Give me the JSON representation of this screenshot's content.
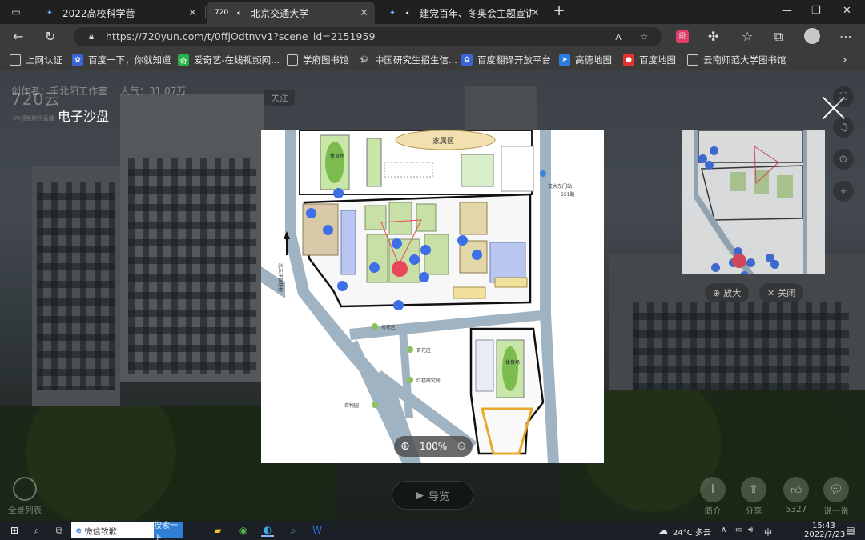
{
  "browser": {
    "tabs": [
      {
        "title": "2022高校科学营",
        "icon": "compass-icon"
      },
      {
        "title": "北京交通大学",
        "icon": "speaker-icon",
        "favicon_text": "720"
      },
      {
        "title": "建党百年、冬奥会主题宣讲",
        "icon": "speaker-icon"
      }
    ],
    "url": "https://720yun.com/t/0ffjOdtnvv1?scene_id=2151959",
    "bookmarks": [
      "上网认证",
      "百度一下，你就知道",
      "爱奇艺-在线视频网...",
      "学府图书馆",
      "中国研究生招生信...",
      "百度翻译开放平台",
      "高德地图",
      "百度地图",
      "云南师范大学图书馆"
    ]
  },
  "pano": {
    "logo": "720云",
    "logo_sub": "VR视频制作直播",
    "author": "创作者：千北阳工作室",
    "popularity": "人气：31.07万",
    "follow_label": "关注",
    "panel_title": "电子沙盘",
    "zoom_level": "100%",
    "mini": {
      "zoom_in": "放大",
      "close": "关闭"
    },
    "guide_label": "导览",
    "panorama_list_label": "全景列表",
    "bottom_actions": [
      {
        "label": "简介",
        "icon": "info-icon"
      },
      {
        "label": "分享",
        "icon": "share-icon"
      },
      {
        "label": "5327",
        "icon": "thumbs-up-icon"
      },
      {
        "label": "说一说",
        "icon": "comment-icon"
      }
    ],
    "map_labels": {
      "family_area": "家属区",
      "stadium_north": "体育场",
      "stadium_south": "体育场",
      "bus_stop": "交大东门站",
      "bus_line": "651路",
      "north_ring": "北三环联想桥",
      "plum_garden": "梅花区",
      "garden_2": "百花区",
      "garden_3": "红楼研究所",
      "garden_4": "前沿区",
      "garden_5": "奇物园"
    },
    "accent_red": "#e9485b",
    "hotspot_blue": "#3d6fe6"
  },
  "taskbar": {
    "search_text": "微信致歉",
    "search_button": "搜索一下",
    "weather": "24°C 多云",
    "time": "15:43",
    "date": "2022/7/23"
  }
}
